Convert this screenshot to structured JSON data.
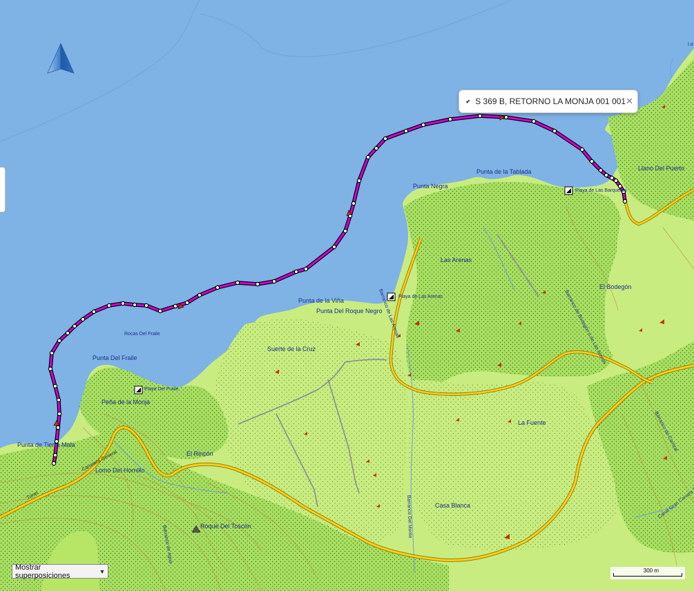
{
  "track": {
    "name": "S 369 B, RETORNO LA MONJA 001 001",
    "color": "#d400d4"
  },
  "controls": {
    "overlay_select": "Mostrar superposiciones",
    "scale_label": "300 m",
    "compass_icon": "north-arrow-icon",
    "close_icon": "close-icon"
  },
  "labels": {
    "punta_tablada": "Punta de la Tablada",
    "punta_negra": "Punta Negra",
    "llano_puerto": "Llano Del Puerto",
    "playa_barqueras": "Playa de Las Barqueras",
    "las_arenas": "Las Arenas",
    "el_bodegon": "El Bodegón",
    "punta_vina": "Punta de la Viña",
    "punta_roque_negro": "Punta Del Roque Negro",
    "playa_arenas": "Playa de Las Arenas",
    "barranco_arenas": "Barranco de Las Arenas",
    "barranco_bodegon": "Barranco de Bodegón o de Las Arenas",
    "rocas_fraile": "Rocas Del Fraile",
    "suerte_cruz": "Suerte de la Cruz",
    "punta_fraile": "Punta Del Fraile",
    "playa_fraile": "Playa Del Fraile",
    "pena_monja": "Peña de la Monja",
    "punta_tierra_mala": "Punta de Tierra Mala",
    "el_rincon": "El Rincón",
    "lomo_hornillo": "Lomo Del Hornillo",
    "tunel": "Túnel",
    "carretera": "Carretera General",
    "roque_toscon": "Roque Del Toscón",
    "barranco_agua": "Barranco de Agua",
    "barranco_monte": "Barranco Del Monte",
    "casa_blanca": "Casa Blanca",
    "la_fuente": "La Fuente",
    "barranco_carrizal": "Barranco de Carrizal",
    "canal": "Canal Gran Canaria Tamaraceite",
    "la": "La"
  },
  "colors": {
    "sea": "#7fb2e5",
    "land_green": "#c6ec7c",
    "dense_green": "#a6dd60",
    "road": "#f4d020",
    "road_edge": "#a07a00",
    "path": "#8a8a9a"
  }
}
